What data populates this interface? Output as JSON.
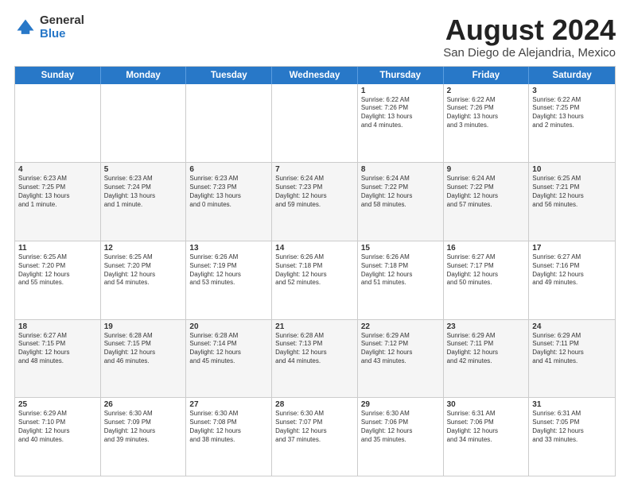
{
  "logo": {
    "general": "General",
    "blue": "Blue"
  },
  "title": {
    "month": "August 2024",
    "location": "San Diego de Alejandria, Mexico"
  },
  "headers": [
    "Sunday",
    "Monday",
    "Tuesday",
    "Wednesday",
    "Thursday",
    "Friday",
    "Saturday"
  ],
  "weeks": [
    [
      {
        "day": "",
        "info": ""
      },
      {
        "day": "",
        "info": ""
      },
      {
        "day": "",
        "info": ""
      },
      {
        "day": "",
        "info": ""
      },
      {
        "day": "1",
        "info": "Sunrise: 6:22 AM\nSunset: 7:26 PM\nDaylight: 13 hours\nand 4 minutes."
      },
      {
        "day": "2",
        "info": "Sunrise: 6:22 AM\nSunset: 7:26 PM\nDaylight: 13 hours\nand 3 minutes."
      },
      {
        "day": "3",
        "info": "Sunrise: 6:22 AM\nSunset: 7:25 PM\nDaylight: 13 hours\nand 2 minutes."
      }
    ],
    [
      {
        "day": "4",
        "info": "Sunrise: 6:23 AM\nSunset: 7:25 PM\nDaylight: 13 hours\nand 1 minute."
      },
      {
        "day": "5",
        "info": "Sunrise: 6:23 AM\nSunset: 7:24 PM\nDaylight: 13 hours\nand 1 minute."
      },
      {
        "day": "6",
        "info": "Sunrise: 6:23 AM\nSunset: 7:23 PM\nDaylight: 13 hours\nand 0 minutes."
      },
      {
        "day": "7",
        "info": "Sunrise: 6:24 AM\nSunset: 7:23 PM\nDaylight: 12 hours\nand 59 minutes."
      },
      {
        "day": "8",
        "info": "Sunrise: 6:24 AM\nSunset: 7:22 PM\nDaylight: 12 hours\nand 58 minutes."
      },
      {
        "day": "9",
        "info": "Sunrise: 6:24 AM\nSunset: 7:22 PM\nDaylight: 12 hours\nand 57 minutes."
      },
      {
        "day": "10",
        "info": "Sunrise: 6:25 AM\nSunset: 7:21 PM\nDaylight: 12 hours\nand 56 minutes."
      }
    ],
    [
      {
        "day": "11",
        "info": "Sunrise: 6:25 AM\nSunset: 7:20 PM\nDaylight: 12 hours\nand 55 minutes."
      },
      {
        "day": "12",
        "info": "Sunrise: 6:25 AM\nSunset: 7:20 PM\nDaylight: 12 hours\nand 54 minutes."
      },
      {
        "day": "13",
        "info": "Sunrise: 6:26 AM\nSunset: 7:19 PM\nDaylight: 12 hours\nand 53 minutes."
      },
      {
        "day": "14",
        "info": "Sunrise: 6:26 AM\nSunset: 7:18 PM\nDaylight: 12 hours\nand 52 minutes."
      },
      {
        "day": "15",
        "info": "Sunrise: 6:26 AM\nSunset: 7:18 PM\nDaylight: 12 hours\nand 51 minutes."
      },
      {
        "day": "16",
        "info": "Sunrise: 6:27 AM\nSunset: 7:17 PM\nDaylight: 12 hours\nand 50 minutes."
      },
      {
        "day": "17",
        "info": "Sunrise: 6:27 AM\nSunset: 7:16 PM\nDaylight: 12 hours\nand 49 minutes."
      }
    ],
    [
      {
        "day": "18",
        "info": "Sunrise: 6:27 AM\nSunset: 7:15 PM\nDaylight: 12 hours\nand 48 minutes."
      },
      {
        "day": "19",
        "info": "Sunrise: 6:28 AM\nSunset: 7:15 PM\nDaylight: 12 hours\nand 46 minutes."
      },
      {
        "day": "20",
        "info": "Sunrise: 6:28 AM\nSunset: 7:14 PM\nDaylight: 12 hours\nand 45 minutes."
      },
      {
        "day": "21",
        "info": "Sunrise: 6:28 AM\nSunset: 7:13 PM\nDaylight: 12 hours\nand 44 minutes."
      },
      {
        "day": "22",
        "info": "Sunrise: 6:29 AM\nSunset: 7:12 PM\nDaylight: 12 hours\nand 43 minutes."
      },
      {
        "day": "23",
        "info": "Sunrise: 6:29 AM\nSunset: 7:11 PM\nDaylight: 12 hours\nand 42 minutes."
      },
      {
        "day": "24",
        "info": "Sunrise: 6:29 AM\nSunset: 7:11 PM\nDaylight: 12 hours\nand 41 minutes."
      }
    ],
    [
      {
        "day": "25",
        "info": "Sunrise: 6:29 AM\nSunset: 7:10 PM\nDaylight: 12 hours\nand 40 minutes."
      },
      {
        "day": "26",
        "info": "Sunrise: 6:30 AM\nSunset: 7:09 PM\nDaylight: 12 hours\nand 39 minutes."
      },
      {
        "day": "27",
        "info": "Sunrise: 6:30 AM\nSunset: 7:08 PM\nDaylight: 12 hours\nand 38 minutes."
      },
      {
        "day": "28",
        "info": "Sunrise: 6:30 AM\nSunset: 7:07 PM\nDaylight: 12 hours\nand 37 minutes."
      },
      {
        "day": "29",
        "info": "Sunrise: 6:30 AM\nSunset: 7:06 PM\nDaylight: 12 hours\nand 35 minutes."
      },
      {
        "day": "30",
        "info": "Sunrise: 6:31 AM\nSunset: 7:06 PM\nDaylight: 12 hours\nand 34 minutes."
      },
      {
        "day": "31",
        "info": "Sunrise: 6:31 AM\nSunset: 7:05 PM\nDaylight: 12 hours\nand 33 minutes."
      }
    ]
  ]
}
